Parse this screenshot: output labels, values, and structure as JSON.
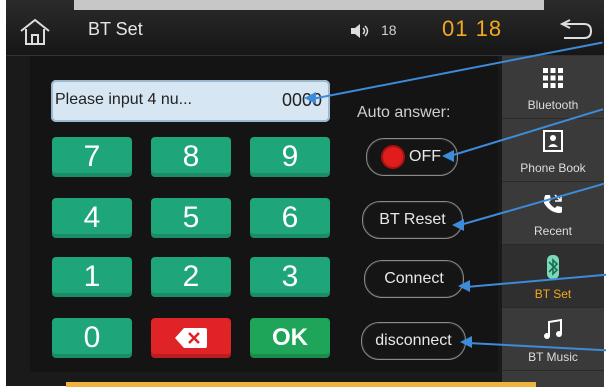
{
  "header": {
    "title": "BT Set",
    "volume": "18",
    "time": "01 18"
  },
  "input": {
    "placeholder": "Please input 4 nu...",
    "value": "0000"
  },
  "keypad": {
    "keys": [
      "7",
      "8",
      "9",
      "4",
      "5",
      "6",
      "1",
      "2",
      "3",
      "0",
      "backspace",
      "OK"
    ]
  },
  "auto_answer": {
    "label": "Auto answer:",
    "state": "OFF"
  },
  "buttons": {
    "bt_reset": "BT Reset",
    "connect": "Connect",
    "disconnect": "disconnect"
  },
  "sidebar": {
    "items": [
      {
        "label": "Bluetooth",
        "icon": "grid-icon"
      },
      {
        "label": "Phone Book",
        "icon": "contacts-icon"
      },
      {
        "label": "Recent",
        "icon": "phone-icon"
      },
      {
        "label": "BT Set",
        "icon": "bluetooth-icon"
      },
      {
        "label": "BT Music",
        "icon": "music-icon"
      }
    ]
  },
  "colors": {
    "accent": "#f1a91e",
    "keypad_green": "#1fa57a",
    "backspace_red": "#e02326",
    "arrow_blue": "#3d8bd9"
  }
}
